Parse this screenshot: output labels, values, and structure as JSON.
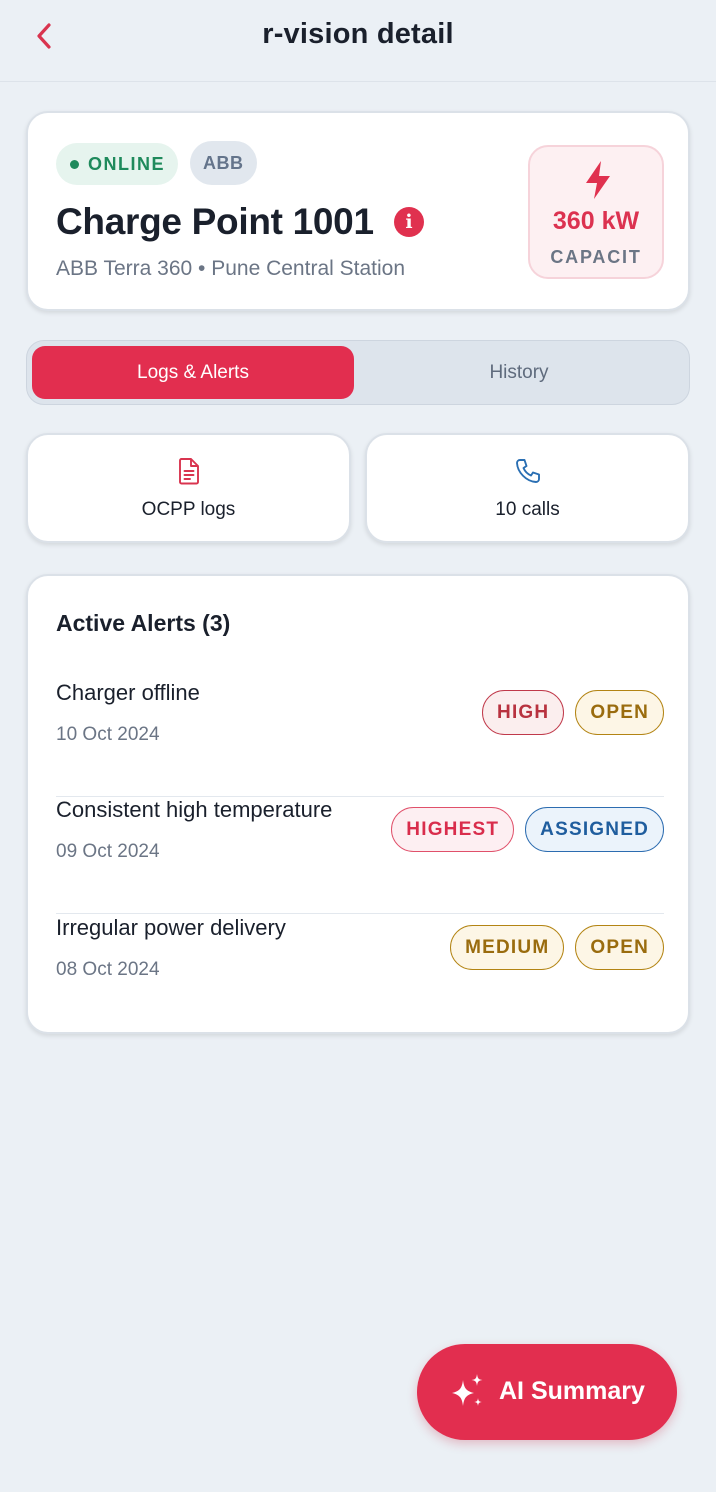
{
  "header": {
    "title": "r-vision detail",
    "back_icon": "chevron-left-icon"
  },
  "charger": {
    "status": "ONLINE",
    "brand": "ABB",
    "name": "Charge Point 1001",
    "subtitle": "ABB Terra 360 • Pune Central Station",
    "capacity_value": "360 kW",
    "capacity_label": "CAPACIT",
    "capacity_icon": "bolt-icon",
    "info_icon": "info-icon"
  },
  "tabs": [
    {
      "label": "Logs & Alerts",
      "active": true
    },
    {
      "label": "History",
      "active": false
    }
  ],
  "actions": [
    {
      "label": "OCPP logs",
      "icon": "document-icon"
    },
    {
      "label": "10 calls",
      "icon": "phone-icon"
    }
  ],
  "alerts": {
    "title": "Active Alerts (3)",
    "items": [
      {
        "title": "Charger offline",
        "date": "10 Oct 2024",
        "severity": "HIGH",
        "status": "OPEN"
      },
      {
        "title": "Consistent high temperature",
        "date": "09 Oct 2024",
        "severity": "HIGHEST",
        "status": "ASSIGNED"
      },
      {
        "title": "Irregular power delivery",
        "date": "08 Oct 2024",
        "severity": "MEDIUM",
        "status": "OPEN"
      }
    ]
  },
  "fab": {
    "label": "AI Summary",
    "icon": "sparkles-icon"
  },
  "colors": {
    "accent": "#e22e4f",
    "online": "#1f8a5c",
    "background": "#ebf0f5"
  }
}
